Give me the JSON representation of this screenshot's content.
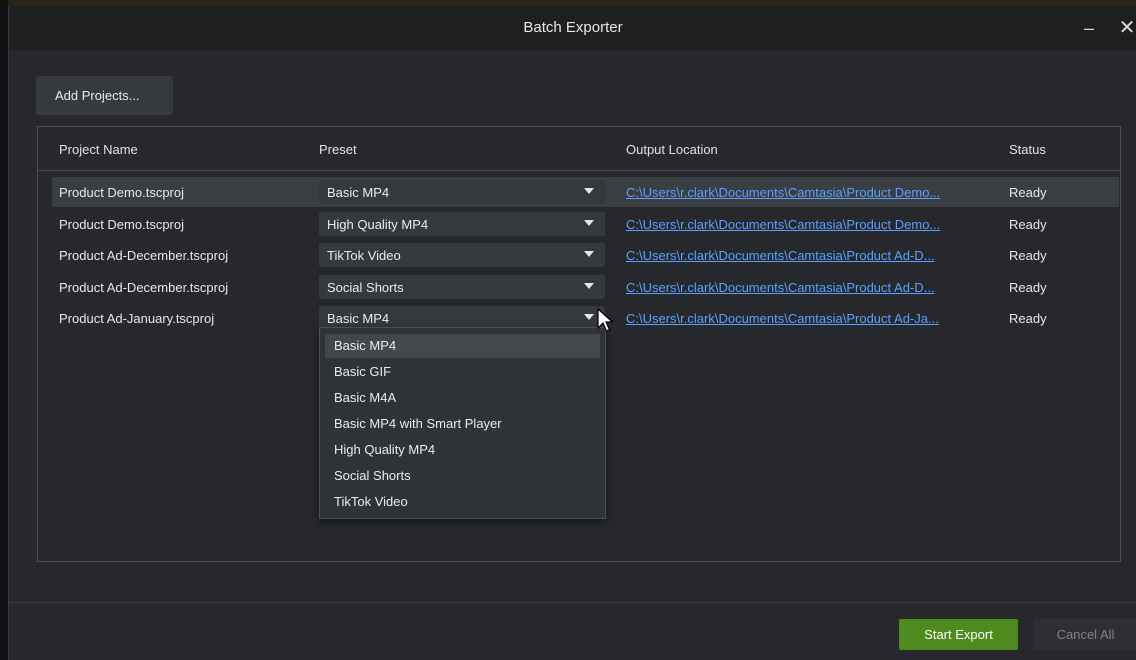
{
  "window": {
    "title": "Batch Exporter",
    "minimize_glyph": "–",
    "close_glyph": "✕"
  },
  "toolbar": {
    "add_projects_label": "Add Projects..."
  },
  "table": {
    "columns": [
      "Project Name",
      "Preset",
      "Output Location",
      "Status"
    ],
    "rows": [
      {
        "name": "Product Demo.tscproj",
        "preset": "Basic MP4",
        "location": "C:\\Users\\r.clark\\Documents\\Camtasia\\Product Demo...",
        "status": "Ready"
      },
      {
        "name": "Product Demo.tscproj",
        "preset": "High Quality MP4",
        "location": "C:\\Users\\r.clark\\Documents\\Camtasia\\Product Demo...",
        "status": "Ready"
      },
      {
        "name": "Product Ad-December.tscproj",
        "preset": "TikTok Video",
        "location": "C:\\Users\\r.clark\\Documents\\Camtasia\\Product Ad-D...",
        "status": "Ready"
      },
      {
        "name": "Product Ad-December.tscproj",
        "preset": "Social Shorts",
        "location": "C:\\Users\\r.clark\\Documents\\Camtasia\\Product Ad-D...",
        "status": "Ready"
      },
      {
        "name": "Product Ad-January.tscproj",
        "preset": "Basic MP4",
        "location": "C:\\Users\\r.clark\\Documents\\Camtasia\\Product Ad-Ja...",
        "status": "Ready"
      }
    ]
  },
  "preset_dropdown": {
    "options": [
      "Basic MP4",
      "Basic GIF",
      "Basic M4A",
      "Basic MP4 with Smart Player",
      "High Quality MP4",
      "Social Shorts",
      "TikTok Video"
    ],
    "highlighted": "Basic MP4"
  },
  "footer": {
    "start_export_label": "Start Export",
    "cancel_all_label": "Cancel All"
  },
  "colors": {
    "accent_green": "#4f8a1e",
    "link_blue": "#5aa0ff",
    "background": "#26282b"
  },
  "icons": {
    "dropdown_arrow": "chevron-down-icon",
    "pointer": "mouse-pointer-icon"
  }
}
